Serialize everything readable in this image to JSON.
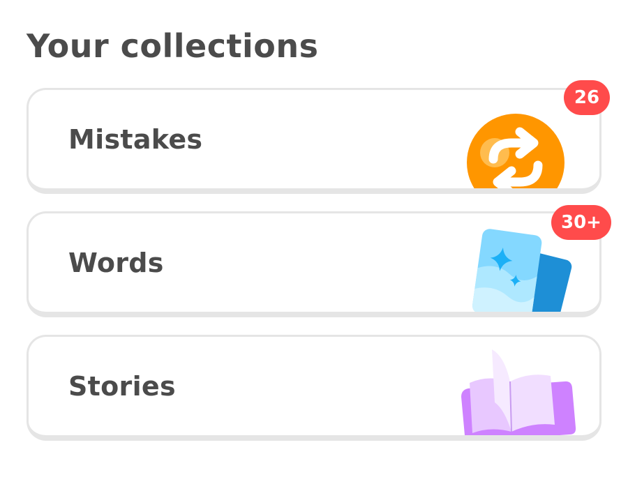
{
  "page": {
    "title": "Your collections"
  },
  "collections": [
    {
      "label": "Mistakes",
      "badge": "26",
      "icon": "refresh-arrows-icon",
      "accent": "#ff9600"
    },
    {
      "label": "Words",
      "badge": "30+",
      "icon": "flashcards-icon",
      "accent": "#84d8ff"
    },
    {
      "label": "Stories",
      "badge": "",
      "icon": "open-book-icon",
      "accent": "#ce82ff"
    }
  ],
  "colors": {
    "text": "#4b4b4b",
    "card_border": "#e5e5e5",
    "badge": "#ff4b4b",
    "badge_text": "#ffffff"
  }
}
